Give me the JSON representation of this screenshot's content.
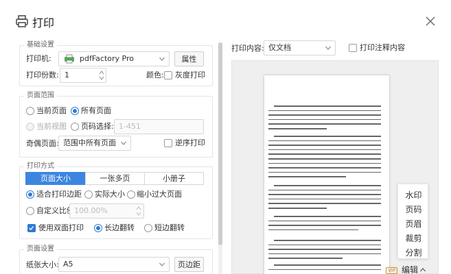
{
  "window": {
    "title": "打印"
  },
  "basic": {
    "group_title": "基础设置",
    "printer_label": "打印机:",
    "printer_value": "pdfFactory Pro",
    "properties_button": "属性",
    "copies_label": "打印份数:",
    "copies_value": "1",
    "color_label": "颜色:",
    "grayscale_label": "灰度打印",
    "grayscale_checked": false
  },
  "page_range": {
    "group_title": "页面范围",
    "current_page": "当前页面",
    "all_pages": "所有页面",
    "selected": "all_pages",
    "current_view": "当前视图",
    "page_select": "页码选择:",
    "page_select_placeholder": "1-451",
    "odd_even_label": "奇偶页面:",
    "odd_even_value": "范围中所有页面",
    "reverse_label": "逆序打印",
    "reverse_checked": false
  },
  "print_mode": {
    "group_title": "打印方式",
    "tabs": [
      "页面大小",
      "一张多页",
      "小册子"
    ],
    "active_tab": 0,
    "fit_margins": "适合打印边距",
    "actual_size": "实际大小",
    "shrink_large": "缩小过大页面",
    "custom_scale": "自定义比例",
    "custom_scale_value": "100.00%",
    "duplex_label": "使用双面打印",
    "duplex_checked": true,
    "long_edge": "长边翻转",
    "short_edge": "短边翻转",
    "flip_selected": "long_edge"
  },
  "page_setup": {
    "group_title": "页面设置",
    "paper_size_label": "纸张大小:",
    "paper_size_value": "A5",
    "margins_button": "页边距"
  },
  "right": {
    "print_content_label": "打印内容:",
    "print_content_value": "仅文档",
    "print_annotations_label": "打印注释内容",
    "print_annotations_checked": false
  },
  "side_menu": [
    "水印",
    "页码",
    "页眉",
    "裁剪",
    "分割"
  ],
  "edit_bar": {
    "vip_badge": "VIP",
    "edit_label": "编辑"
  },
  "colors": {
    "accent": "#3d86e0",
    "radio": "#2f7ad6"
  },
  "icons": {
    "printer": "printer-icon",
    "close": "close-icon",
    "chevron": "chevron-down-icon",
    "pdf_printer": "pdf-printer-icon"
  }
}
